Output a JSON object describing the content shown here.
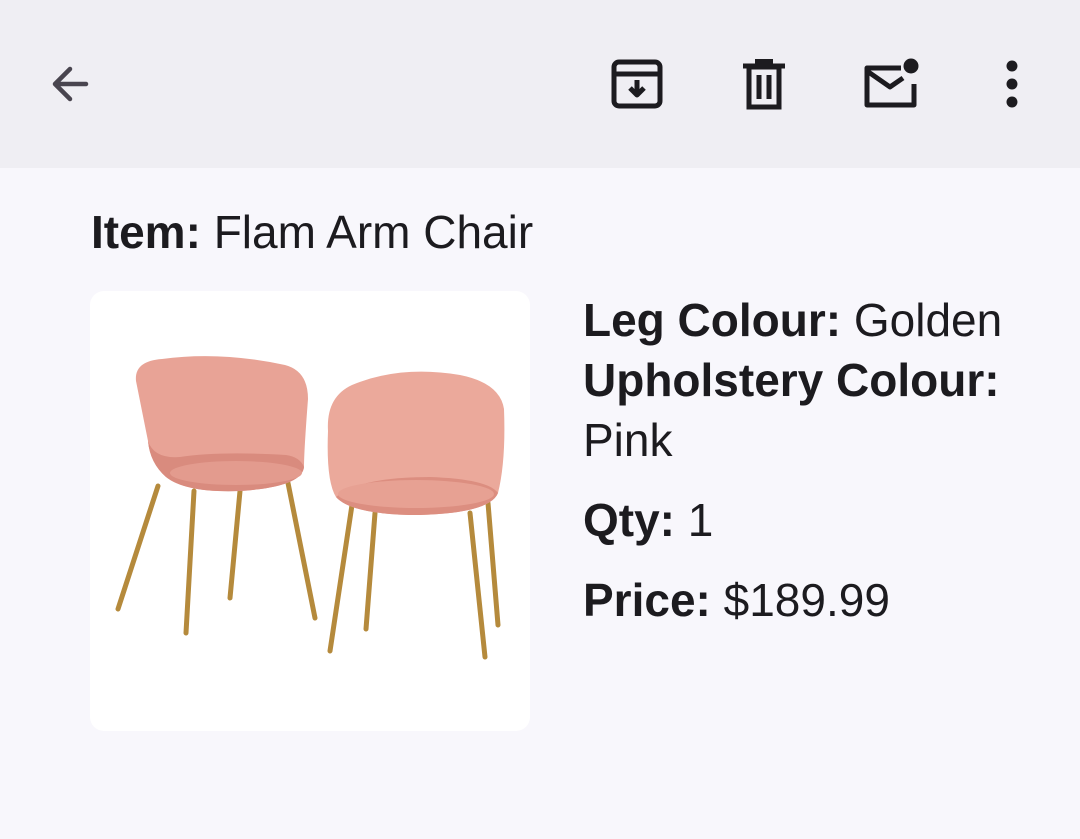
{
  "toolbar": {
    "back_icon": "arrow-left-icon",
    "archive_icon": "archive-icon",
    "delete_icon": "trash-icon",
    "unread_icon": "mark-unread-icon",
    "more_icon": "more-vert-icon"
  },
  "item": {
    "label": "Item:",
    "value": "Flam Arm Chair"
  },
  "product_image": {
    "subject": "two pink chairs with golden legs"
  },
  "details": {
    "leg_colour_label": "Leg Colour:",
    "leg_colour_value": "Golden",
    "upholstery_label": "Upholstery Colour:",
    "upholstery_value": "Pink",
    "qty_label": "Qty:",
    "qty_value": "1",
    "price_label": "Price:",
    "price_value": "$189.99"
  },
  "colors": {
    "topbar_bg": "#efeef3",
    "page_bg": "#f8f7fc",
    "chair_pink": "#e8a396",
    "leg_gold": "#b58a3c"
  }
}
